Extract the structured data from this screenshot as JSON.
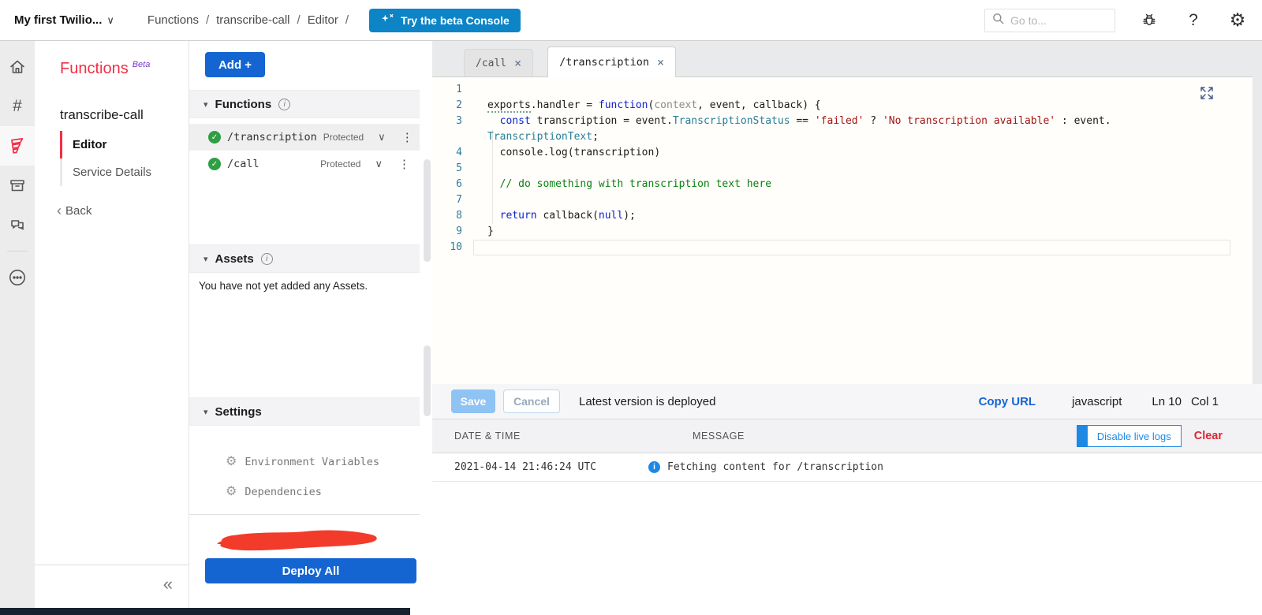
{
  "topbar": {
    "account_label": "My first Twilio...",
    "breadcrumbs": [
      "Functions",
      "transcribe-call",
      "Editor"
    ],
    "breadcrumb_sep": "/",
    "beta_button_label": "Try the beta Console",
    "search_placeholder": "Go to..."
  },
  "icons": {
    "chevron_down": "∨",
    "triangle_down": "▾",
    "close": "×",
    "kebab": "⋮",
    "back": "‹",
    "collapse": "«",
    "help": "?",
    "gear": "⚙",
    "hash": "#",
    "info": "i",
    "check": "✓",
    "dots": "•••"
  },
  "left_panel": {
    "title": "Functions",
    "beta_tag": "Beta",
    "service_name": "transcribe-call",
    "nav": [
      {
        "label": "Editor",
        "active": true
      },
      {
        "label": "Service Details",
        "active": false
      }
    ],
    "back_label": "Back"
  },
  "middle_panel": {
    "add_button_label": "Add +",
    "functions_section": {
      "label": "Functions",
      "items": [
        {
          "name": "/transcription",
          "badge": "Protected",
          "selected": true
        },
        {
          "name": "/call",
          "badge": "Protected",
          "selected": false
        }
      ]
    },
    "assets_section": {
      "label": "Assets",
      "empty_text": "You have not yet added any Assets."
    },
    "settings_section": {
      "label": "Settings",
      "items": [
        {
          "label": "Environment Variables"
        },
        {
          "label": "Dependencies"
        }
      ]
    },
    "deploy_button_label": "Deploy All"
  },
  "editor": {
    "tabs": [
      {
        "label": "/call",
        "active": false
      },
      {
        "label": "/transcription",
        "active": true
      }
    ],
    "code_lines": [
      {
        "num": "1",
        "segs": []
      },
      {
        "num": "2",
        "segs": [
          {
            "t": "exports",
            "c": "squiggle"
          },
          {
            "t": ".handler = ",
            "c": "plain"
          },
          {
            "t": "function",
            "c": "kw"
          },
          {
            "t": "(",
            "c": "plain"
          },
          {
            "t": "context",
            "c": "param"
          },
          {
            "t": ", event, callback) {",
            "c": "plain"
          }
        ]
      },
      {
        "num": "3",
        "segs": [
          {
            "t": "  ",
            "c": "plain"
          },
          {
            "t": "const",
            "c": "kw"
          },
          {
            "t": " transcription = event.",
            "c": "plain"
          },
          {
            "t": "TranscriptionStatus",
            "c": "type"
          },
          {
            "t": " == ",
            "c": "plain"
          },
          {
            "t": "'failed'",
            "c": "str"
          },
          {
            "t": " ? ",
            "c": "plain"
          },
          {
            "t": "'No transcription available'",
            "c": "str"
          },
          {
            "t": " : event.",
            "c": "plain"
          }
        ]
      },
      {
        "num": "",
        "segs": [
          {
            "t": "TranscriptionText",
            "c": "type"
          },
          {
            "t": ";",
            "c": "plain"
          }
        ]
      },
      {
        "num": "4",
        "segs": [
          {
            "t": "  console.log(transcription)",
            "c": "plain"
          }
        ]
      },
      {
        "num": "5",
        "segs": []
      },
      {
        "num": "6",
        "segs": [
          {
            "t": "  // do something with transcription text here",
            "c": "comment"
          }
        ]
      },
      {
        "num": "7",
        "segs": []
      },
      {
        "num": "8",
        "segs": [
          {
            "t": "  ",
            "c": "plain"
          },
          {
            "t": "return",
            "c": "kw"
          },
          {
            "t": " callback(",
            "c": "plain"
          },
          {
            "t": "null",
            "c": "kw"
          },
          {
            "t": ");",
            "c": "plain"
          }
        ]
      },
      {
        "num": "9",
        "segs": [
          {
            "t": "}",
            "c": "plain"
          }
        ]
      },
      {
        "num": "10",
        "segs": [],
        "current": true
      }
    ],
    "footer": {
      "save_label": "Save",
      "cancel_label": "Cancel",
      "status_text": "Latest version is deployed",
      "copy_url_label": "Copy URL",
      "language": "javascript",
      "line_label": "Ln 10",
      "col_label": "Col 1"
    }
  },
  "logs": {
    "columns": [
      "DATE & TIME",
      "MESSAGE"
    ],
    "disable_button_label": "Disable live logs",
    "clear_button_label": "Clear",
    "rows": [
      {
        "datetime": "2021-04-14 21:46:24 UTC",
        "message": "Fetching content for /transcription"
      }
    ]
  },
  "colors": {
    "brand_red": "#f22f46",
    "beta_purple": "#7a3bc8",
    "action_blue": "#1465d2",
    "console_blue": "#0d84c6",
    "green_check": "#2f9e44",
    "log_info_blue": "#1e88e5",
    "clear_red": "#d92732",
    "code_keyword": "#0d1fd4",
    "code_type": "#267f99",
    "code_string": "#a31515",
    "code_comment": "#0a8012",
    "line_number": "#2e7ca3"
  }
}
